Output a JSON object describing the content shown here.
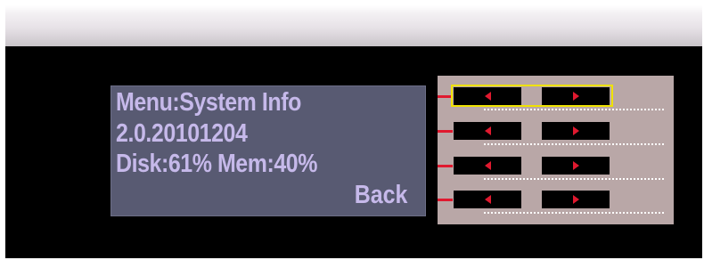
{
  "lcd": {
    "line1": "Menu:System Info",
    "line2": "2.0.20101204",
    "line3": "Disk:61% Mem:40%",
    "back_label": "Back"
  },
  "controls": {
    "rows": [
      {
        "selected": true
      },
      {
        "selected": false
      },
      {
        "selected": false
      },
      {
        "selected": false
      }
    ],
    "left_icon": "left-arrow-icon",
    "right_icon": "right-arrow-icon"
  },
  "colors": {
    "lcd_background": "#585a72",
    "lcd_text": "#c6b9ea",
    "panel_background": "#b9a7a7",
    "arrow": "#e0192f",
    "selection": "#efe200"
  }
}
